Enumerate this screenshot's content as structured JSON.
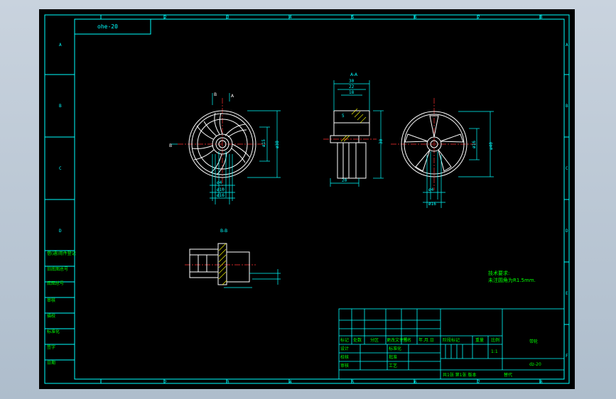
{
  "colors": {
    "background": "#000000",
    "frame": "#00ffff",
    "part": "#ffffff",
    "dimension": "#00ffff",
    "centerline": "#ff3030",
    "text": "#00ff00",
    "hatch": "#ffff00"
  },
  "drawing": {
    "code_box": "ohe-20",
    "col_labels": [
      "1",
      "2",
      "3",
      "4",
      "5",
      "6",
      "7",
      "8"
    ],
    "row_labels": [
      "A",
      "B",
      "C",
      "D",
      "E",
      "F"
    ],
    "views": {
      "front": {
        "section_mark_top": "B",
        "section_mark_arrow": "A",
        "section_mark_side": "B",
        "dims": [
          "ø38",
          "ø15",
          "ø4",
          "ø10",
          "ø16"
        ]
      },
      "section_aa": {
        "title": "A-A",
        "dims": [
          "30",
          "22",
          "18",
          "5",
          "30",
          "20"
        ]
      },
      "rear": {
        "dims": [
          "ø16",
          "ø40",
          "ø4",
          "ø16"
        ]
      },
      "section_bb": {
        "title": "B-B"
      }
    },
    "notes": {
      "line1": "技术要求:",
      "line2": "未注圆角为R1.5mm."
    },
    "left_strip": [
      "借(通)用件登记",
      "旧底图总号",
      "底图总号",
      "签字",
      "日期",
      "描图",
      "描校",
      "标准化",
      "审核",
      "日期"
    ],
    "title_block": {
      "headers": [
        "标记",
        "处数",
        "分区",
        "更改文件号",
        "签名",
        "年.月.日"
      ],
      "rows_left": [
        "设计",
        "校核",
        "审核",
        "工艺"
      ],
      "mid_labels": [
        "标准化",
        "批准"
      ],
      "stage_label": "阶段标记",
      "weight_label": "重量",
      "scale_label": "比例",
      "scale_value": "1:1",
      "part_name": "带轮",
      "drawing_no": "dz-20",
      "sheets": "共1张 第1张 版本",
      "replace": "替代"
    }
  }
}
